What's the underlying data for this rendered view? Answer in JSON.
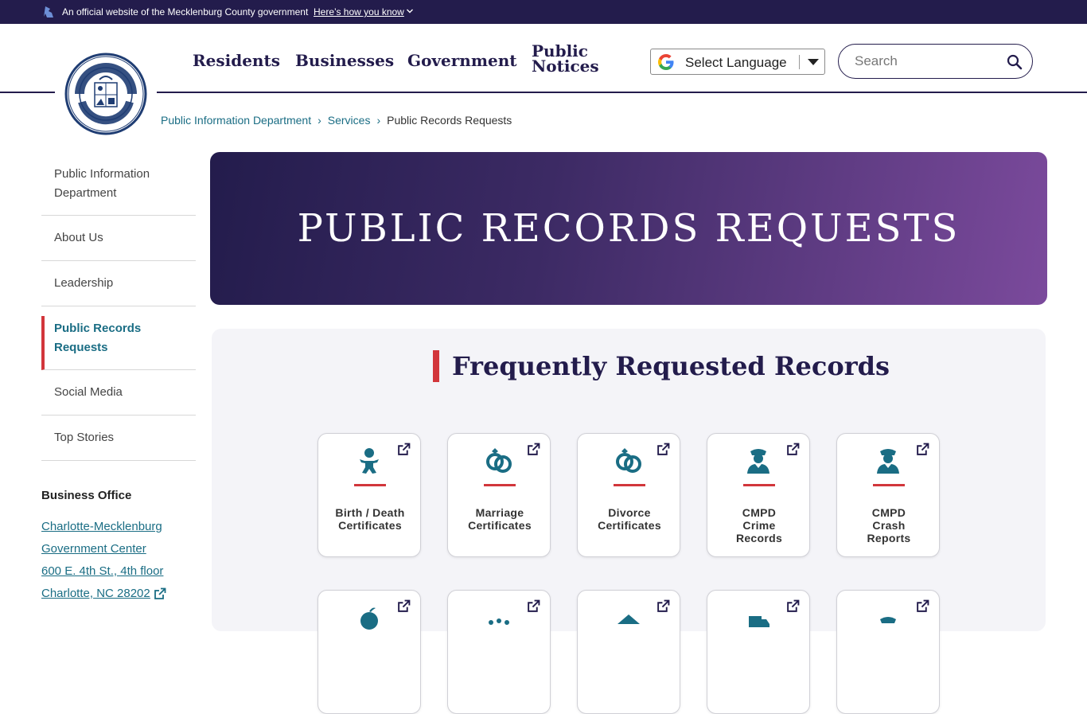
{
  "banner": {
    "official_text": "An official website of the Mecklenburg County government",
    "how_link": "Here’s how you know"
  },
  "nav": {
    "residents": "Residents",
    "businesses": "Businesses",
    "government": "Government",
    "public_notices_line1": "Public",
    "public_notices_line2": "Notices"
  },
  "language": {
    "label": "Select Language"
  },
  "search": {
    "placeholder": "Search"
  },
  "breadcrumb": {
    "item1": "Public Information Department",
    "item2": "Services",
    "current": "Public Records Requests"
  },
  "sidebar": {
    "items": [
      {
        "label": "Public Information Department"
      },
      {
        "label": "About Us"
      },
      {
        "label": "Leadership"
      },
      {
        "label": "Public Records Requests",
        "active": true
      },
      {
        "label": "Social Media"
      },
      {
        "label": "Top Stories"
      }
    ],
    "business_office": {
      "title": "Business Office",
      "line1": "Charlotte-Mecklenburg",
      "line2": "Government Center",
      "line3": "600 E. 4th St., 4th floor",
      "line4": "Charlotte, NC 28202"
    }
  },
  "hero": {
    "title": "PUBLIC RECORDS REQUESTS"
  },
  "records": {
    "title": "Frequently Requested Records",
    "cards": [
      {
        "label": "Birth / Death Certificates",
        "icon": "baby-icon"
      },
      {
        "label": "Marriage Certificates",
        "icon": "rings-icon"
      },
      {
        "label": "Divorce Certificates",
        "icon": "rings-icon"
      },
      {
        "label": "CMPD Crime Records",
        "icon": "police-officer-icon"
      },
      {
        "label": "CMPD Crash Reports",
        "icon": "police-officer-icon"
      }
    ]
  },
  "colors": {
    "navy": "#231c4c",
    "teal": "#1a6d84",
    "red": "#d2363b",
    "purple": "#7b4a9c"
  }
}
